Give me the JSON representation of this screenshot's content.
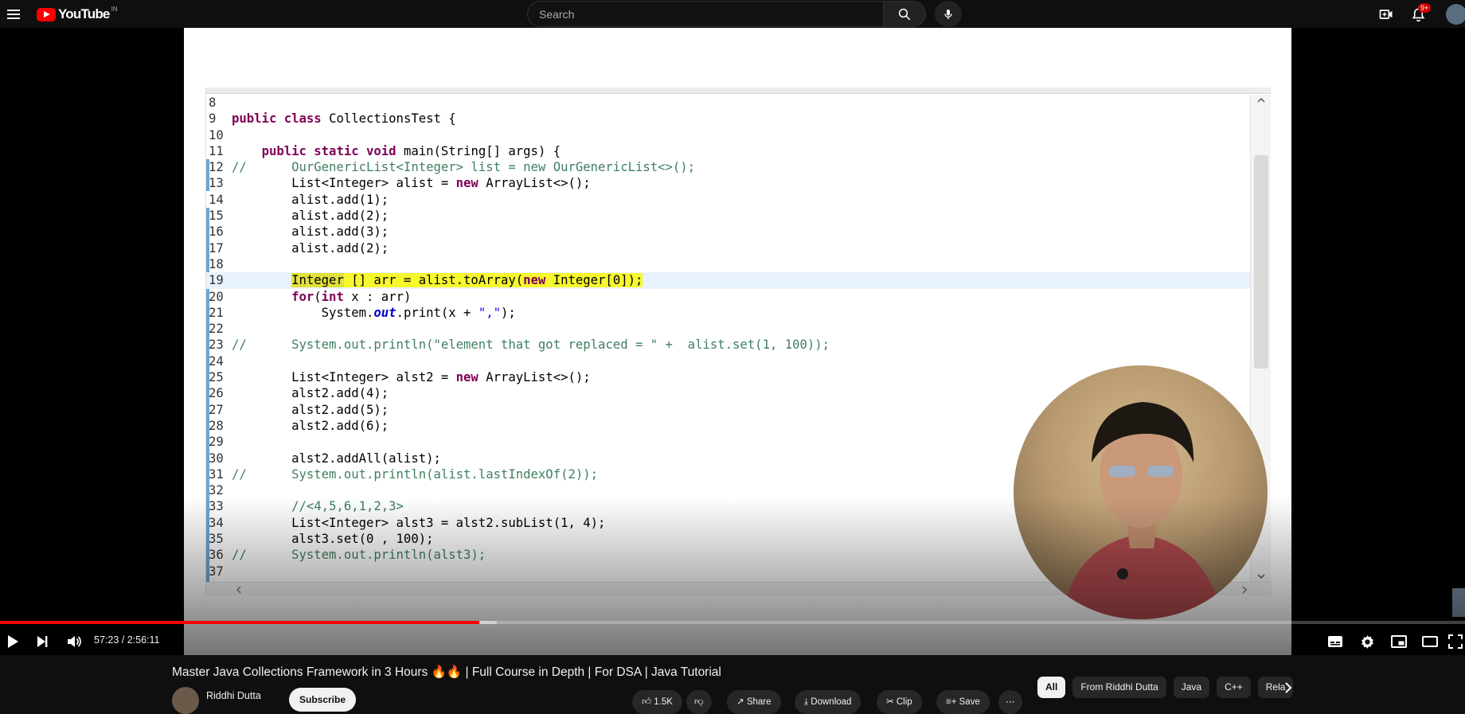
{
  "header": {
    "logo_text": "YouTube",
    "region": "IN",
    "search_placeholder": "Search",
    "notification_count": "9+"
  },
  "editor": {
    "lines": [
      {
        "n": "8",
        "segs": []
      },
      {
        "n": "9",
        "segs": [
          {
            "t": "public class ",
            "c": "kw"
          },
          {
            "t": "CollectionsTest {",
            "c": ""
          }
        ]
      },
      {
        "n": "10",
        "segs": []
      },
      {
        "n": "11",
        "segs": [
          {
            "t": "    ",
            "c": ""
          },
          {
            "t": "public static void ",
            "c": "kw"
          },
          {
            "t": "main(String[] args) {",
            "c": ""
          }
        ]
      },
      {
        "n": "12",
        "segs": [
          {
            "t": "//      OurGenericList<Integer> list = new OurGenericList<>();",
            "c": "cm"
          }
        ]
      },
      {
        "n": "13",
        "segs": [
          {
            "t": "        List<Integer> alist = ",
            "c": ""
          },
          {
            "t": "new ",
            "c": "kw"
          },
          {
            "t": "ArrayList<>();",
            "c": ""
          }
        ]
      },
      {
        "n": "14",
        "segs": [
          {
            "t": "        alist.add(1);",
            "c": ""
          }
        ]
      },
      {
        "n": "15",
        "segs": [
          {
            "t": "        alist.add(2);",
            "c": ""
          }
        ]
      },
      {
        "n": "16",
        "segs": [
          {
            "t": "        alist.add(3);",
            "c": ""
          }
        ]
      },
      {
        "n": "17",
        "segs": [
          {
            "t": "        alist.add(2);",
            "c": ""
          }
        ]
      },
      {
        "n": "18",
        "segs": []
      },
      {
        "n": "19",
        "current": true,
        "segs": [
          {
            "t": "        ",
            "c": ""
          },
          {
            "t": "Integer",
            "c": "hl2"
          },
          {
            "t": " [] arr = alist.toArray(",
            "c": "hl"
          },
          {
            "t": "new ",
            "c": "kw hl"
          },
          {
            "t": "Integer[0]);",
            "c": "hl"
          }
        ]
      },
      {
        "n": "20",
        "segs": [
          {
            "t": "        ",
            "c": ""
          },
          {
            "t": "for",
            "c": "kw"
          },
          {
            "t": "(",
            "c": ""
          },
          {
            "t": "int ",
            "c": "kw"
          },
          {
            "t": "x : arr)",
            "c": ""
          }
        ]
      },
      {
        "n": "21",
        "segs": [
          {
            "t": "            System.",
            "c": ""
          },
          {
            "t": "out",
            "c": "fld"
          },
          {
            "t": ".print(x + ",
            "c": ""
          },
          {
            "t": "\",\"",
            "c": "str"
          },
          {
            "t": ");",
            "c": ""
          }
        ]
      },
      {
        "n": "22",
        "segs": []
      },
      {
        "n": "23",
        "segs": [
          {
            "t": "//      System.out.println(\"element that got replaced = \" +  alist.set(1, 100));",
            "c": "cm"
          }
        ]
      },
      {
        "n": "24",
        "segs": []
      },
      {
        "n": "25",
        "segs": [
          {
            "t": "        List<Integer> alst2 = ",
            "c": ""
          },
          {
            "t": "new ",
            "c": "kw"
          },
          {
            "t": "ArrayList<>();",
            "c": ""
          }
        ]
      },
      {
        "n": "26",
        "segs": [
          {
            "t": "        alst2.add(4);",
            "c": ""
          }
        ]
      },
      {
        "n": "27",
        "segs": [
          {
            "t": "        alst2.add(5);",
            "c": ""
          }
        ]
      },
      {
        "n": "28",
        "segs": [
          {
            "t": "        alst2.add(6);",
            "c": ""
          }
        ]
      },
      {
        "n": "29",
        "segs": []
      },
      {
        "n": "30",
        "segs": [
          {
            "t": "        alst2.addAll(alist);",
            "c": ""
          }
        ]
      },
      {
        "n": "31",
        "segs": [
          {
            "t": "//      System.out.println(alist.lastIndexOf(2));",
            "c": "cm"
          }
        ]
      },
      {
        "n": "32",
        "segs": []
      },
      {
        "n": "33",
        "segs": [
          {
            "t": "        //<4,5,6,1,2,3>",
            "c": "cm"
          }
        ]
      },
      {
        "n": "34",
        "segs": [
          {
            "t": "        List<Integer> alst3 = alst2.subList(1, 4);",
            "c": ""
          }
        ]
      },
      {
        "n": "35",
        "segs": [
          {
            "t": "        alst3.set(0 , 100);",
            "c": ""
          }
        ]
      },
      {
        "n": "36",
        "segs": [
          {
            "t": "//      System.out.println(alst3);",
            "c": "cm"
          }
        ]
      },
      {
        "n": "37",
        "segs": []
      }
    ]
  },
  "player": {
    "time_current": "57:23",
    "time_total": "2:56:11",
    "time_display": "57:23 / 2:56:11",
    "played_fraction": 0.327,
    "buffered_fraction": 0.339
  },
  "video": {
    "title": "Master Java Collections Framework in 3 Hours 🔥🔥 | Full Course in Depth | For DSA | Java Tutorial",
    "channel": "Riddhi Dutta",
    "subscribe_label": "Subscribe",
    "likes": "1.5K",
    "share_label": "Share",
    "download_label": "Download",
    "clip_label": "Clip",
    "save_label": "Save"
  },
  "chips": [
    "All",
    "From Riddhi Dutta",
    "Java",
    "C++",
    "Rela"
  ]
}
